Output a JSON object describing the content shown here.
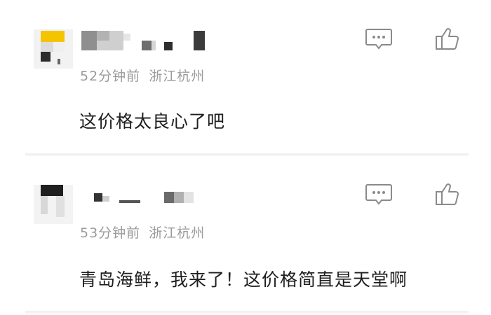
{
  "comments": [
    {
      "time": "52分钟前",
      "location": "浙江杭州",
      "text": "这价格太良心了吧",
      "reply_icon": "comment-bubble-icon",
      "like_icon": "thumbs-up-icon"
    },
    {
      "time": "53分钟前",
      "location": "浙江杭州",
      "text": "青岛海鲜，我来了！这价格简直是天堂啊",
      "reply_icon": "comment-bubble-icon",
      "like_icon": "thumbs-up-icon"
    }
  ],
  "colors": {
    "meta_text": "#9a9a9a",
    "body_text": "#1e1e1e",
    "icon_stroke": "#8a8a8a",
    "divider": "#efefef",
    "avatar_accent": "#f5c400"
  }
}
